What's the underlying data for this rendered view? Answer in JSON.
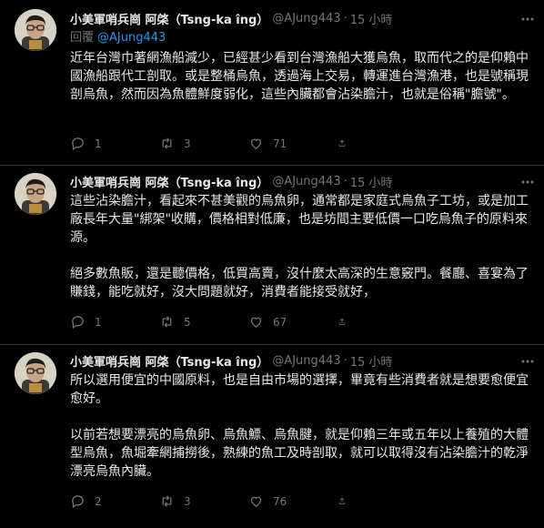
{
  "tweets": [
    {
      "author_name": "小美軍哨兵崗 阿棨（Tsng-ka îng）",
      "handle": "@AJung443",
      "time": "15 小時",
      "replying_label": "回覆",
      "replying_to": "@AJung443",
      "paragraphs": [
        "近年台灣巾著網漁船減少，已經甚少看到台灣漁船大獲烏魚，取而代之的是仰賴中國漁船跟代工剖取。或是整桶烏魚，透過海上交易，轉運進台灣漁港，也是號稱現剖烏魚，然而因為魚體鮮度弱化，這些內臟都會沾染膽汁，也就是俗稱\"膽號\"。"
      ],
      "reply_count": "1",
      "retweet_count": "3",
      "like_count": "71"
    },
    {
      "author_name": "小美軍哨兵崗 阿棨（Tsng-ka îng）",
      "handle": "@AJung443",
      "time": "15 小時",
      "paragraphs": [
        "這些沾染膽汁，看起來不甚美觀的烏魚卵，通常都是家庭式烏魚子工坊，或是加工廠長年大量\"綁架\"收購，價格相對低廉，也是坊間主要低價一口吃烏魚子的原料來源。",
        "絕多數魚販，還是聽價格，低買高賣，沒什麼太高深的生意竅門。餐廳、喜宴為了賺錢，能吃就好，沒大問題就好，消費者能接受就好，"
      ],
      "reply_count": "1",
      "retweet_count": "5",
      "like_count": "67"
    },
    {
      "author_name": "小美軍哨兵崗 阿棨（Tsng-ka îng）",
      "handle": "@AJung443",
      "time": "15 小時",
      "paragraphs": [
        "所以選用便宜的中國原料，也是自由市場的選擇，畢竟有些消費者就是想要愈便宜愈好。",
        "以前若想要漂亮的烏魚卵、烏魚鰾、烏魚腱，就是仰賴三年或五年以上養殖的大體型烏魚，魚堀牽網捕撈後，熟練的魚工及時剖取，就可以取得沒有沾染膽汁的乾淨漂亮烏魚內臟。"
      ],
      "reply_count": "2",
      "retweet_count": "3",
      "like_count": "76"
    }
  ],
  "icons": {
    "more": "more-horizontal-icon",
    "reply": "reply-bubble-icon",
    "retweet": "retweet-arrows-icon",
    "like": "heart-icon",
    "share": "share-upload-icon"
  },
  "colors": {
    "background": "#000000",
    "text": "#e7e9ea",
    "muted": "#71767b",
    "link": "#1d9bf0",
    "divider": "#2f3336"
  }
}
